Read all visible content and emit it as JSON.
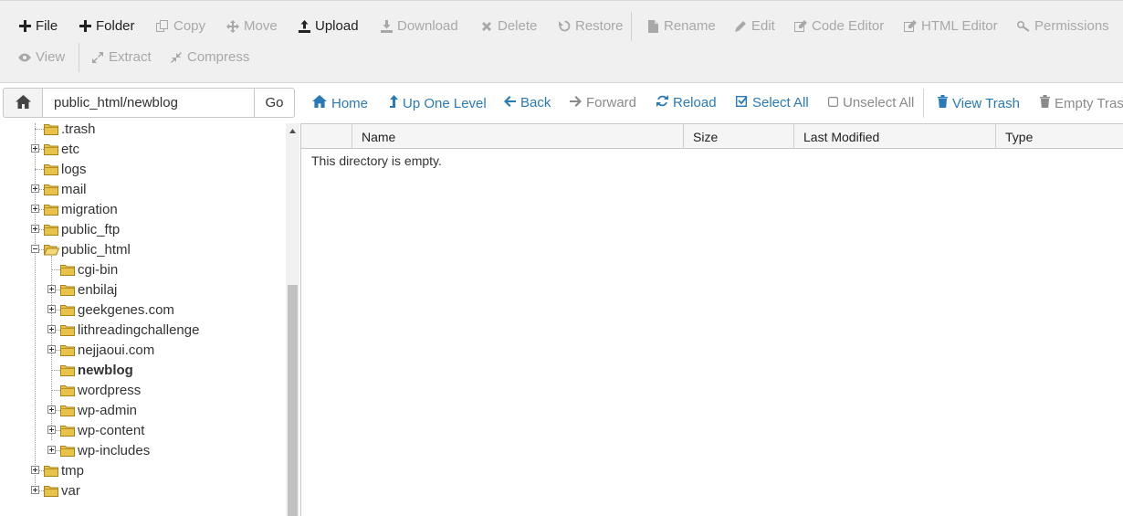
{
  "toolbar": {
    "row1": [
      {
        "label": "File",
        "icon": "plus-icon",
        "enabled": true
      },
      {
        "label": "Folder",
        "icon": "plus-icon",
        "enabled": true
      },
      {
        "label": "Copy",
        "icon": "copy-icon",
        "enabled": false
      },
      {
        "label": "Move",
        "icon": "move-icon",
        "enabled": false
      },
      {
        "label": "Upload",
        "icon": "upload-icon",
        "enabled": true
      },
      {
        "label": "Download",
        "icon": "download-icon",
        "enabled": false
      },
      {
        "label": "Delete",
        "icon": "close-icon",
        "enabled": false
      },
      {
        "label": "Restore",
        "icon": "undo-icon",
        "enabled": false
      },
      {
        "label": "Rename",
        "icon": "file-icon",
        "enabled": false
      },
      {
        "label": "Edit",
        "icon": "pencil-icon",
        "enabled": false
      },
      {
        "label": "Code Editor",
        "icon": "edit-square-icon",
        "enabled": false
      },
      {
        "label": "HTML Editor",
        "icon": "edit-square-icon",
        "enabled": false
      },
      {
        "label": "Permissions",
        "icon": "key-icon",
        "enabled": false
      }
    ],
    "row2": [
      {
        "label": "View",
        "icon": "eye-icon",
        "enabled": false
      },
      {
        "label": "Extract",
        "icon": "expand-icon",
        "enabled": false
      },
      {
        "label": "Compress",
        "icon": "compress-icon",
        "enabled": false
      }
    ]
  },
  "pathbar": {
    "path_value": "public_html/newblog",
    "go_label": "Go",
    "nav": [
      {
        "label": "Home",
        "icon": "home-icon",
        "enabled": true
      },
      {
        "label": "Up One Level",
        "icon": "level-up-icon",
        "enabled": true
      },
      {
        "label": "Back",
        "icon": "arrow-left-icon",
        "enabled": true
      },
      {
        "label": "Forward",
        "icon": "arrow-right-icon",
        "enabled": false
      },
      {
        "label": "Reload",
        "icon": "refresh-icon",
        "enabled": true
      },
      {
        "label": "Select All",
        "icon": "checkbox-checked-icon",
        "enabled": true
      },
      {
        "label": "Unselect All",
        "icon": "checkbox-empty-icon",
        "enabled": false
      },
      {
        "label": "View Trash",
        "icon": "trash-icon",
        "enabled": true
      },
      {
        "label": "Empty Trash",
        "icon": "trash-icon",
        "enabled": false
      }
    ]
  },
  "tree": {
    "items": [
      {
        "label": ".trash",
        "level": 1,
        "expander": "none",
        "bold": false
      },
      {
        "label": "etc",
        "level": 1,
        "expander": "plus",
        "bold": false
      },
      {
        "label": "logs",
        "level": 1,
        "expander": "none",
        "bold": false
      },
      {
        "label": "mail",
        "level": 1,
        "expander": "plus",
        "bold": false
      },
      {
        "label": "migration",
        "level": 1,
        "expander": "plus",
        "bold": false
      },
      {
        "label": "public_ftp",
        "level": 1,
        "expander": "plus",
        "bold": false
      },
      {
        "label": "public_html",
        "level": 1,
        "expander": "minus",
        "bold": false,
        "open": true
      },
      {
        "label": "cgi-bin",
        "level": 2,
        "expander": "none",
        "bold": false
      },
      {
        "label": "enbilaj",
        "level": 2,
        "expander": "plus",
        "bold": false
      },
      {
        "label": "geekgenes.com",
        "level": 2,
        "expander": "plus",
        "bold": false
      },
      {
        "label": "lithreadingchallenge",
        "level": 2,
        "expander": "plus",
        "bold": false
      },
      {
        "label": "nejjaoui.com",
        "level": 2,
        "expander": "plus",
        "bold": false
      },
      {
        "label": "newblog",
        "level": 2,
        "expander": "none",
        "bold": true
      },
      {
        "label": "wordpress",
        "level": 2,
        "expander": "none",
        "bold": false
      },
      {
        "label": "wp-admin",
        "level": 2,
        "expander": "plus",
        "bold": false
      },
      {
        "label": "wp-content",
        "level": 2,
        "expander": "plus",
        "bold": false
      },
      {
        "label": "wp-includes",
        "level": 2,
        "expander": "plus",
        "bold": false
      },
      {
        "label": "tmp",
        "level": 1,
        "expander": "plus",
        "bold": false
      },
      {
        "label": "var",
        "level": 1,
        "expander": "plus",
        "bold": false
      }
    ]
  },
  "table": {
    "columns": [
      "Name",
      "Size",
      "Last Modified",
      "Type"
    ],
    "empty_message": "This directory is empty."
  },
  "colors": {
    "link": "#2a7ab8",
    "folder": "#e8c24a",
    "folder_stroke": "#a88418"
  }
}
